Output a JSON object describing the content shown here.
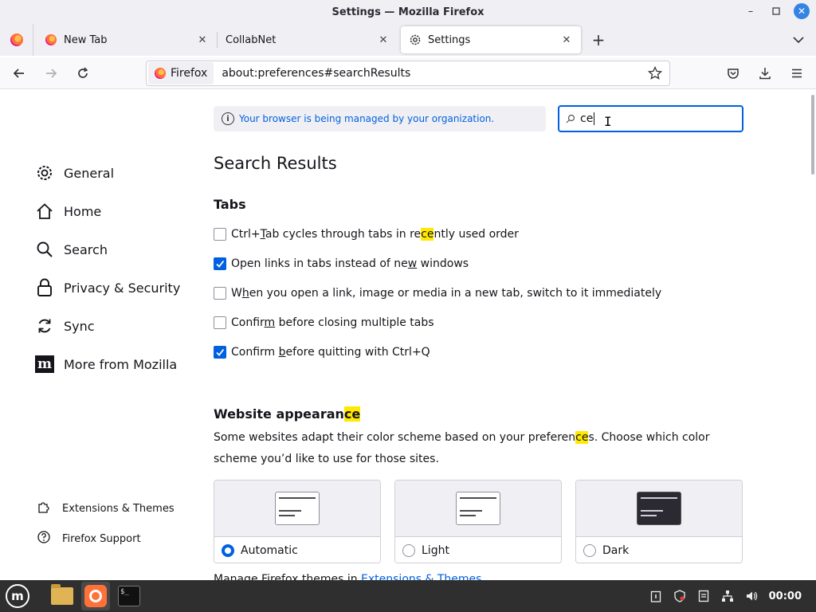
{
  "window": {
    "title": "Settings — Mozilla Firefox"
  },
  "tabs": [
    {
      "label": "New Tab",
      "active": false
    },
    {
      "label": "CollabNet",
      "active": false
    },
    {
      "label": "Settings",
      "active": true
    }
  ],
  "navbar": {
    "identity_label": "Firefox",
    "url": "about:preferences#searchResults"
  },
  "banner": {
    "text": "Your browser is being managed by your organization."
  },
  "search": {
    "value": "ce"
  },
  "sidebar": {
    "categories": [
      {
        "label": "General",
        "icon": "gear-icon"
      },
      {
        "label": "Home",
        "icon": "home-icon"
      },
      {
        "label": "Search",
        "icon": "search-icon"
      },
      {
        "label": "Privacy & Security",
        "icon": "lock-icon"
      },
      {
        "label": "Sync",
        "icon": "sync-icon"
      },
      {
        "label": "More from Mozilla",
        "icon": "mozilla-icon"
      }
    ],
    "footer": [
      {
        "label": "Extensions & Themes",
        "icon": "puzzle-icon"
      },
      {
        "label": "Firefox Support",
        "icon": "help-icon"
      }
    ]
  },
  "main": {
    "heading": "Search Results",
    "tabs_group": {
      "title": "Tabs",
      "options": [
        {
          "label": "Ctrl+Tab cycles through tabs in recently used order",
          "checked": false
        },
        {
          "label": "Open links in tabs instead of new windows",
          "checked": true
        },
        {
          "label": "When you open a link, image or media in a new tab, switch to it immediately",
          "checked": false
        },
        {
          "label": "Confirm before closing multiple tabs",
          "checked": false
        },
        {
          "label": "Confirm before quitting with Ctrl+Q",
          "checked": true
        }
      ]
    },
    "website_appearance": {
      "title": "Website appearance",
      "description": "Some websites adapt their color scheme based on your preferences. Choose which color scheme you'd like to use for those sites.",
      "schemes": [
        {
          "label": "Automatic",
          "selected": true
        },
        {
          "label": "Light",
          "selected": false
        },
        {
          "label": "Dark",
          "selected": false
        }
      ],
      "manage_text": "Manage Firefox themes in",
      "manage_link": "Extensions & Themes"
    }
  },
  "taskbar": {
    "clock": "00:00"
  },
  "colors": {
    "accent": "#0060df",
    "highlight": "#ffe900",
    "taskbar": "#2f2f2f"
  }
}
